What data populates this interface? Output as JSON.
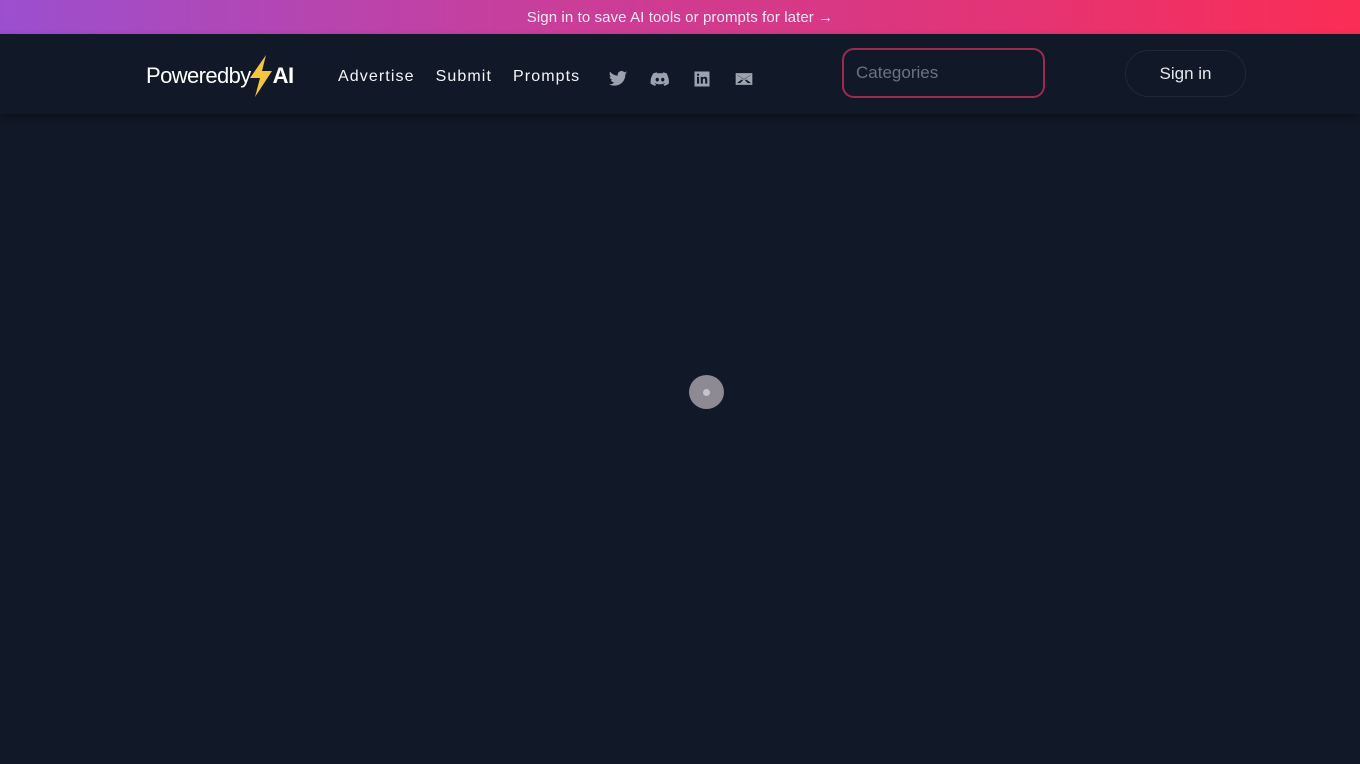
{
  "banner": {
    "text": "Sign in to save AI tools or prompts for later →"
  },
  "header": {
    "logo": {
      "word": "Poweredby",
      "suffix": "AI",
      "icon": "lightning-bolt-icon"
    },
    "nav": [
      {
        "label": "Advertise"
      },
      {
        "label": "Submit"
      },
      {
        "label": "Prompts"
      }
    ],
    "social": [
      {
        "icon": "twitter-icon"
      },
      {
        "icon": "discord-icon"
      },
      {
        "icon": "linkedin-icon"
      },
      {
        "icon": "email-icon"
      }
    ],
    "search": {
      "placeholder": "Categories",
      "value": ""
    },
    "signin_label": "Sign in"
  },
  "main": {
    "loading": true
  },
  "colors": {
    "background": "#111827",
    "banner_gradient_start": "#9b4fcf",
    "banner_gradient_end": "#fb2d55",
    "search_border": "#9b2c4f",
    "bolt": "#f5c542"
  }
}
